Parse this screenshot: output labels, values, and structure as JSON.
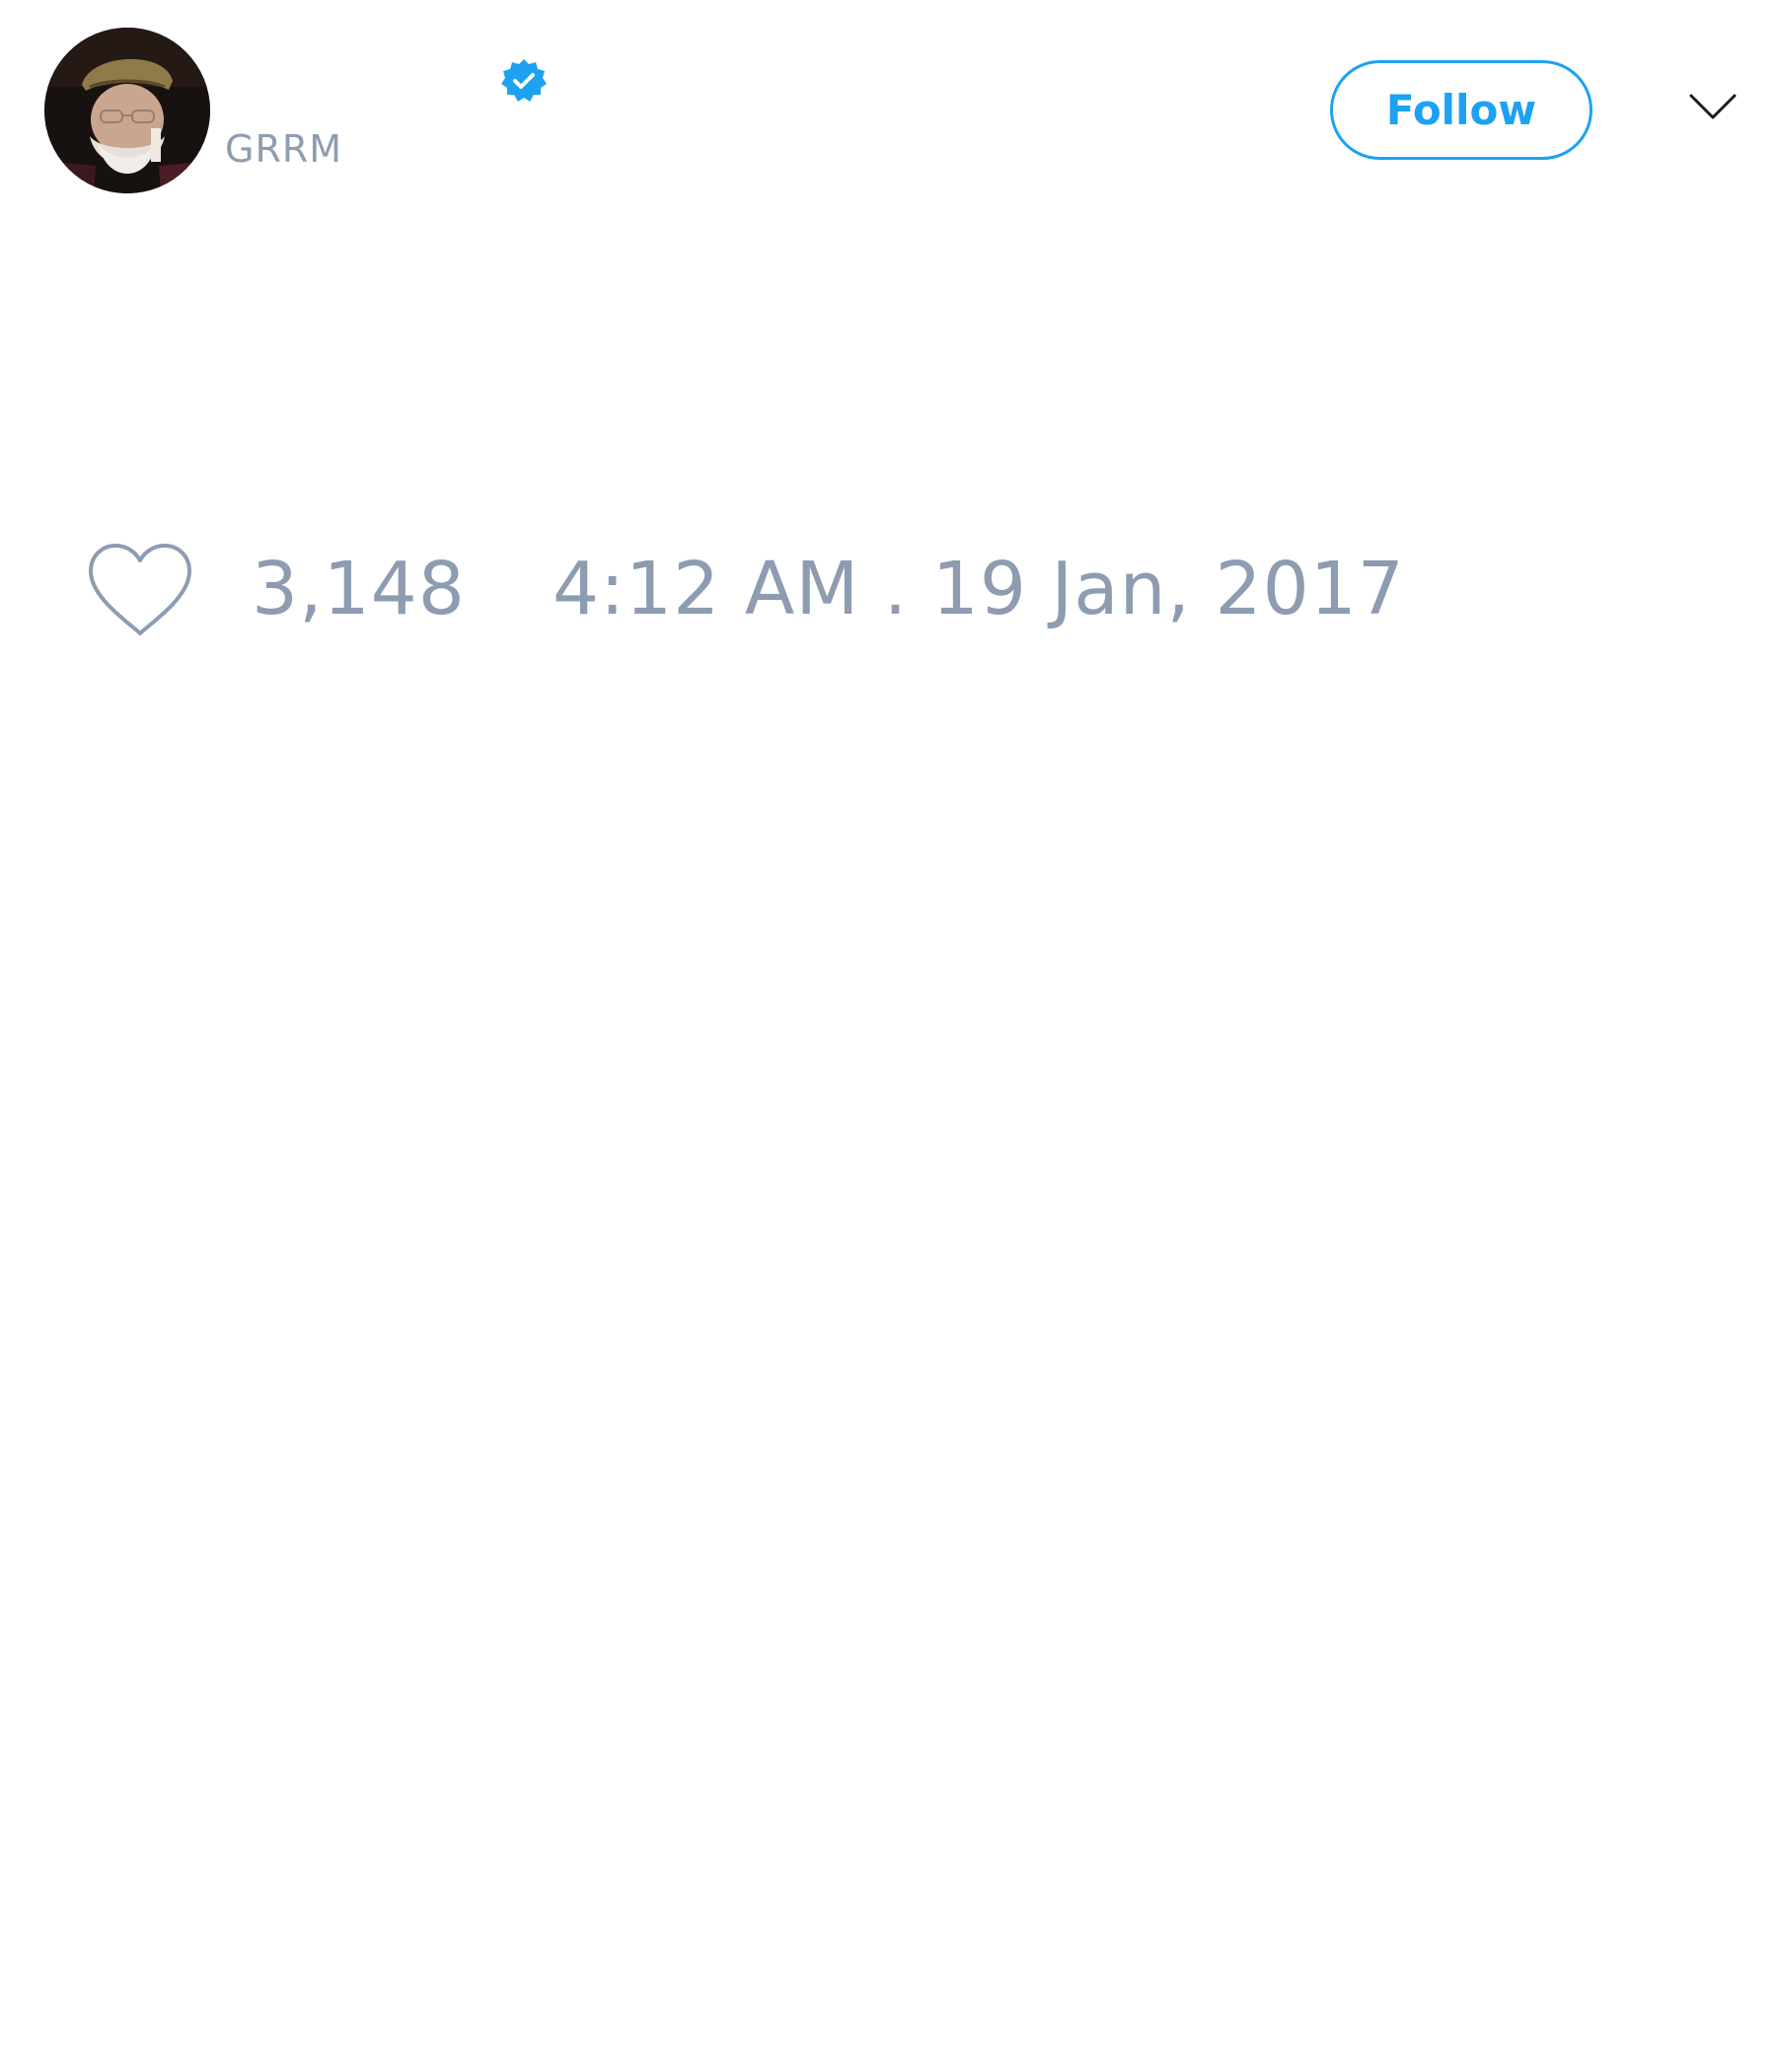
{
  "tweet": {
    "author": {
      "handle": "GRRM",
      "verified": true,
      "avatar_icon": "profile-photo"
    },
    "header": {
      "follow_label": "Follow",
      "menu_icon": "chevron-down-icon"
    },
    "footer": {
      "like_icon": "heart-outline-icon",
      "like_count": "3,148",
      "timestamp": "4:12 AM . 19 Jan, 2017"
    }
  },
  "colors": {
    "accent": "#1da1f2",
    "muted_text": "#8e9cb1",
    "background": "#ffffff"
  }
}
